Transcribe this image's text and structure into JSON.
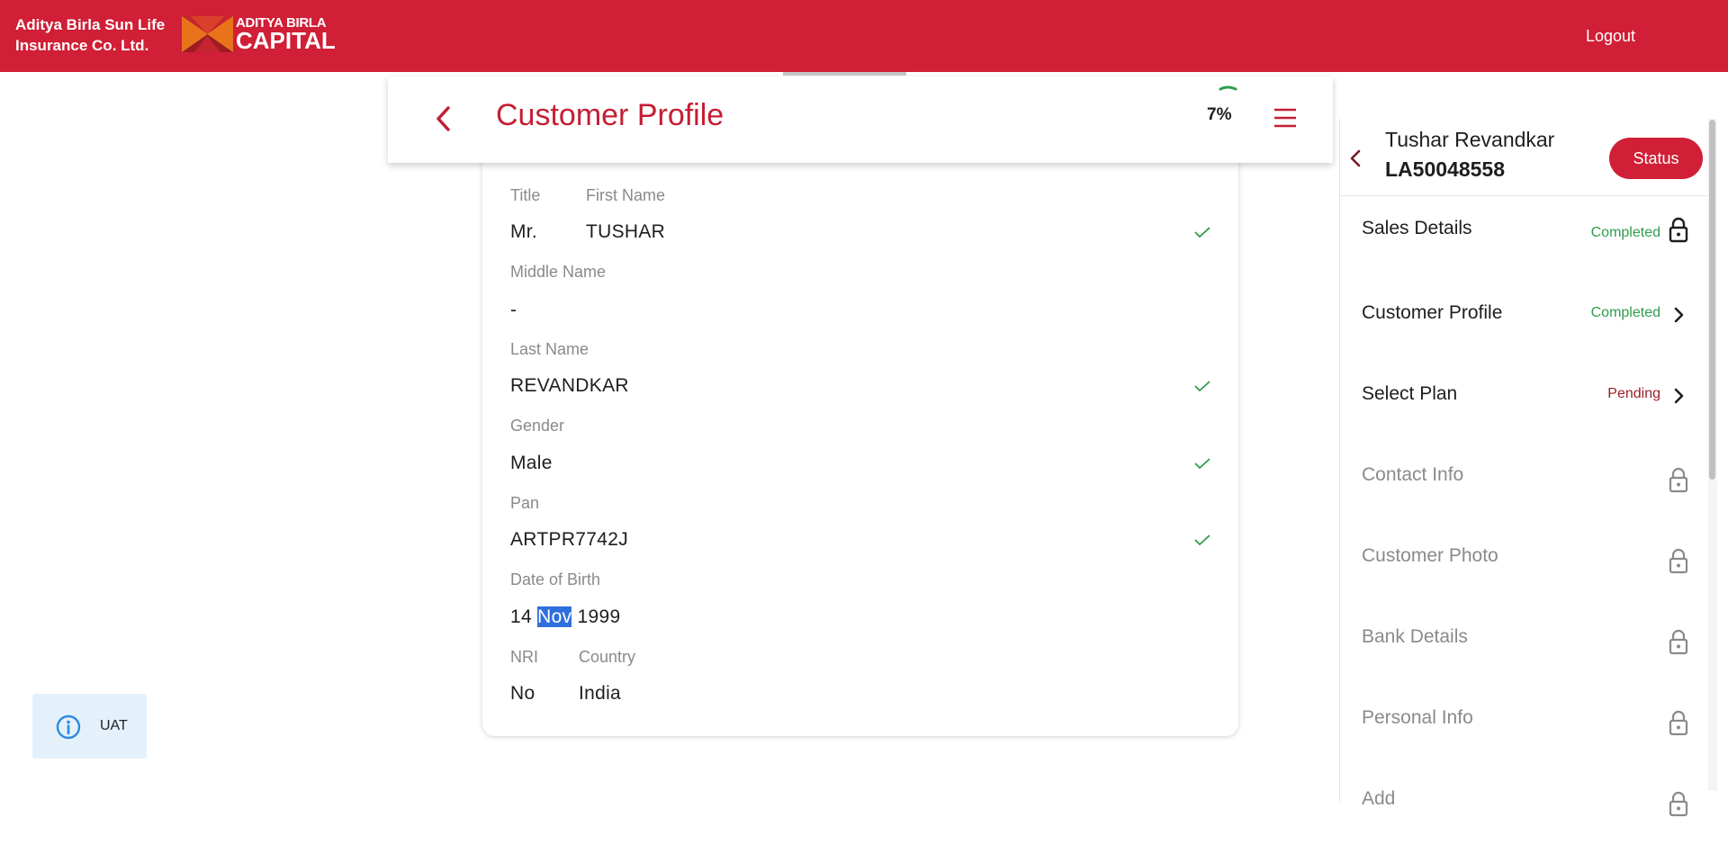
{
  "brand": {
    "line1": "Aditya Birla Sun Life",
    "line2": "Insurance Co. Ltd.",
    "logo_line1": "ADITYA BIRLA",
    "logo_line2": "CAPITAL",
    "color": "#d01f36"
  },
  "nav": {
    "logout_label": "Logout"
  },
  "header": {
    "title": "Customer Profile",
    "progress_text": "7%",
    "progress_value": 0.07
  },
  "form": {
    "title_label": "Title",
    "title_value": "Mr.",
    "first_name_label": "First Name",
    "first_name_value": "TUSHAR",
    "middle_name_label": "Middle Name",
    "middle_name_value": "-",
    "last_name_label": "Last Name",
    "last_name_value": "REVANDKAR",
    "gender_label": "Gender",
    "gender_value": "Male",
    "pan_label": "Pan",
    "pan_value": "ARTPR7742J",
    "dob_label": "Date of Birth",
    "dob_day": "14",
    "dob_month": "Nov",
    "dob_year": "1999",
    "nri_label": "NRI",
    "nri_value": "No",
    "country_label": "Country",
    "country_value": "India"
  },
  "env_badge": {
    "label": "UAT"
  },
  "side": {
    "customer_name": "Tushar Revandkar",
    "application_id": "LA50048558",
    "status_button": "Status",
    "steps": [
      {
        "label": "Sales Details",
        "status": "Completed",
        "icon": "lock-icon"
      },
      {
        "label": "Customer Profile",
        "status": "Completed",
        "icon": "chevron-right-icon"
      },
      {
        "label": "Select Plan",
        "status": "Pending",
        "icon": "chevron-right-icon"
      },
      {
        "label": "Contact Info",
        "status": "",
        "icon": "lock-icon"
      },
      {
        "label": "Customer Photo",
        "status": "",
        "icon": "lock-icon"
      },
      {
        "label": "Bank Details",
        "status": "",
        "icon": "lock-icon"
      },
      {
        "label": "Personal Info",
        "status": "",
        "icon": "lock-icon"
      },
      {
        "label": "Add",
        "status": "",
        "icon": "lock-icon"
      }
    ]
  },
  "colors": {
    "accent": "#d01f36",
    "completed": "#2e9e4f",
    "pending": "#9a1f2a",
    "check": "#2e9e4f"
  }
}
